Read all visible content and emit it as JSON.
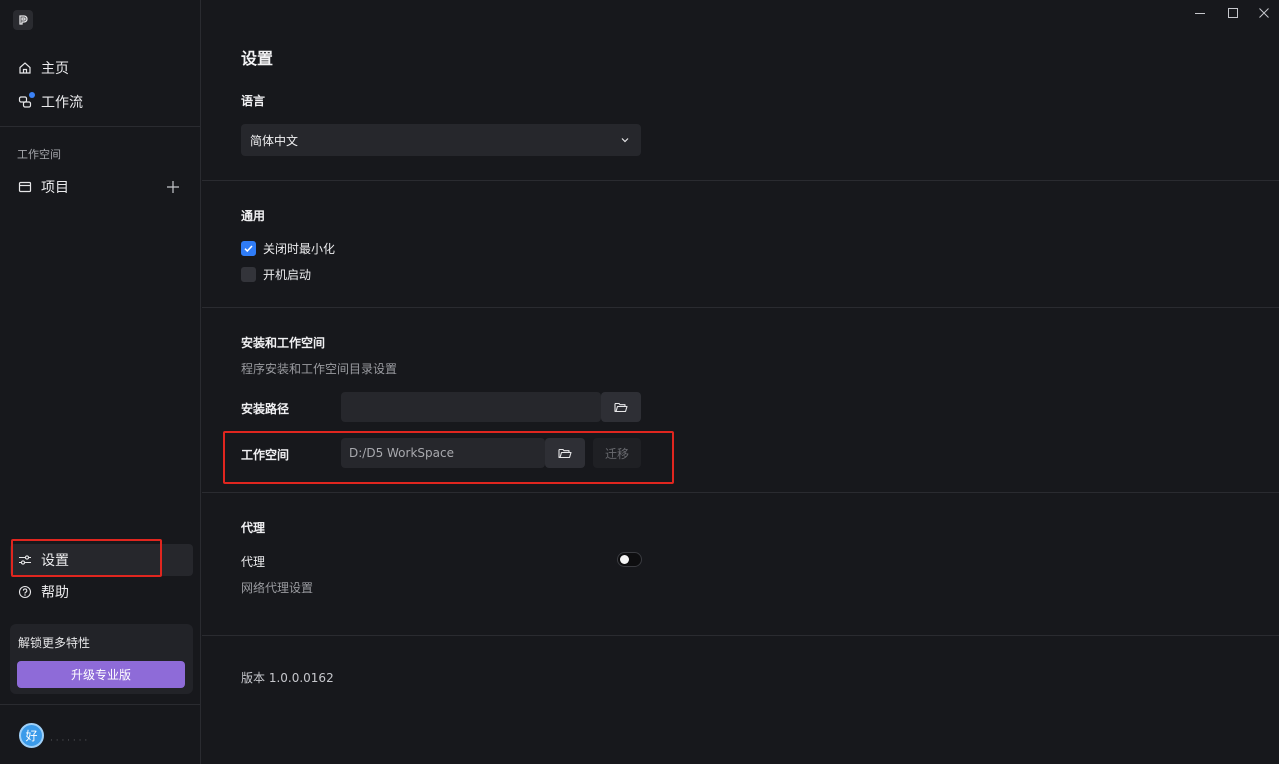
{
  "sidebar": {
    "nav": [
      {
        "label": "主页",
        "icon": "home-icon"
      },
      {
        "label": "工作流",
        "icon": "workflow-icon",
        "badge": true
      }
    ],
    "workspace_section_title": "工作空间",
    "projects_label": "项目",
    "bottom_nav": [
      {
        "label": "设置",
        "icon": "sliders-icon",
        "active": true
      },
      {
        "label": "帮助",
        "icon": "help-icon"
      }
    ],
    "upgrade": {
      "title": "解锁更多特性",
      "button": "升级专业版"
    },
    "user": {
      "avatar_text": "好",
      "name": "· · · · · · ·"
    }
  },
  "main": {
    "title": "设置",
    "language": {
      "title": "语言",
      "selected": "简体中文"
    },
    "general": {
      "title": "通用",
      "minimize_on_close": {
        "label": "关闭时最小化",
        "checked": true
      },
      "launch_on_startup": {
        "label": "开机启动",
        "checked": false
      }
    },
    "install": {
      "title": "安装和工作空间",
      "description": "程序安装和工作空间目录设置",
      "install_path_label": "安装路径",
      "install_path_value": "",
      "workspace_label": "工作空间",
      "workspace_value": "D:/D5 WorkSpace",
      "migrate_label": "迁移"
    },
    "proxy": {
      "title": "代理",
      "label": "代理",
      "description": "网络代理设置",
      "enabled": false
    },
    "version": "版本 1.0.0.0162"
  },
  "colors": {
    "background": "#17181c",
    "accent": "#2f7cf6",
    "upgrade": "#8e6bd8",
    "annotation": "#e0261f"
  }
}
